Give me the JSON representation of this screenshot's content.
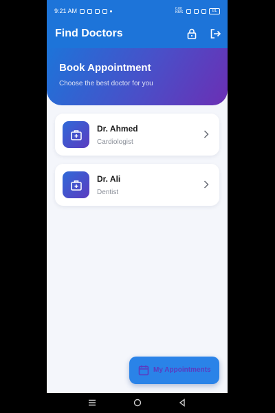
{
  "status_bar": {
    "time": "9:21 AM",
    "network_speed": "0.00 KB/S",
    "battery": "81"
  },
  "header": {
    "title": "Find Doctors",
    "lock_icon": "lock-icon",
    "logout_icon": "logout-icon",
    "color": "#1d74d9"
  },
  "banner": {
    "title": "Book Appointment",
    "subtitle": "Choose the best doctor for you",
    "gradient": [
      "#1d74d9",
      "#6b2fb4"
    ]
  },
  "doctors": [
    {
      "name": "Dr. Ahmed",
      "specialty": "Cardiologist",
      "icon": "medical-kit-icon"
    },
    {
      "name": "Dr. Ali",
      "specialty": "Dentist",
      "icon": "medical-kit-icon"
    }
  ],
  "fab": {
    "label": "My Appointments",
    "icon": "calendar-icon",
    "color": "#2a83e8"
  },
  "system_nav": {
    "menu": "menu-icon",
    "home": "home-icon",
    "back": "back-icon"
  }
}
